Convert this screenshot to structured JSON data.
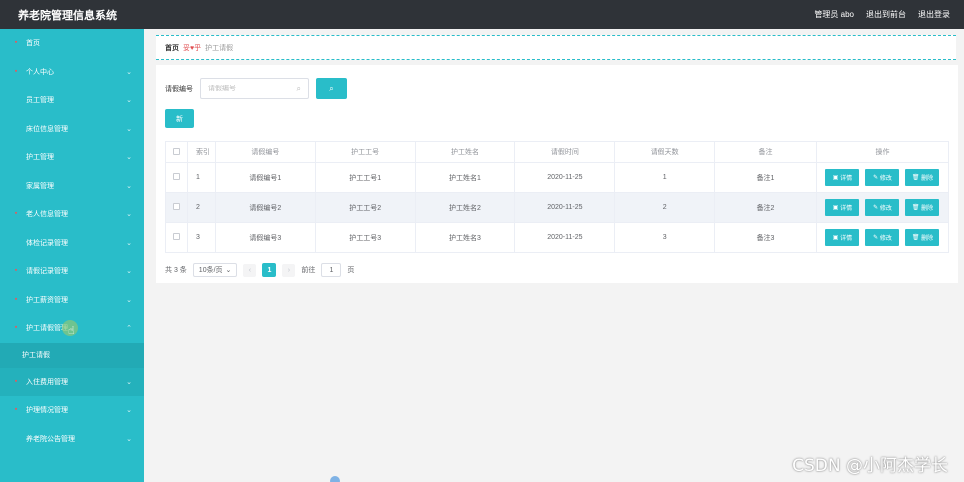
{
  "app": {
    "title": "养老院管理信息系统"
  },
  "topbar": {
    "user": "管理员 abo",
    "back": "退出到前台",
    "logout": "退出登录"
  },
  "sidebar": {
    "items": [
      {
        "label": "首页",
        "chevron": false
      },
      {
        "label": "个人中心",
        "chevron": true
      },
      {
        "label": "员工管理",
        "chevron": true
      },
      {
        "label": "床位信息管理",
        "chevron": true
      },
      {
        "label": "护工管理",
        "chevron": true
      },
      {
        "label": "家属管理",
        "chevron": true
      },
      {
        "label": "老人信息管理",
        "chevron": true
      },
      {
        "label": "体检记录管理",
        "chevron": true
      },
      {
        "label": "请假记录管理",
        "chevron": true
      },
      {
        "label": "护工薪资管理",
        "chevron": true
      },
      {
        "label": "护工请假管理",
        "chevron": true,
        "expanded": true
      }
    ],
    "sub_item": "护工请假",
    "items_after": [
      {
        "label": "入住费用管理",
        "chevron": true
      },
      {
        "label": "护理情况管理",
        "chevron": true
      },
      {
        "label": "养老院公告管理",
        "chevron": true
      }
    ]
  },
  "breadcrumb": {
    "home": "首页",
    "sep": "妥♥乎",
    "current": "护工请假"
  },
  "search": {
    "label": "请假编号",
    "placeholder": "请假编号",
    "button_icon": "search-icon"
  },
  "add_button": {
    "label": "新"
  },
  "table": {
    "headers": [
      "",
      "索引",
      "请假编号",
      "护工工号",
      "护工姓名",
      "请假时间",
      "请假天数",
      "备注",
      "操作"
    ],
    "rows": [
      {
        "index": "1",
        "code": "请假编号1",
        "worker_no": "护工工号1",
        "worker_name": "护工姓名1",
        "date": "2020-11-25",
        "days": "1",
        "remark": "备注1"
      },
      {
        "index": "2",
        "code": "请假编号2",
        "worker_no": "护工工号2",
        "worker_name": "护工姓名2",
        "date": "2020-11-25",
        "days": "2",
        "remark": "备注2"
      },
      {
        "index": "3",
        "code": "请假编号3",
        "worker_no": "护工工号3",
        "worker_name": "护工姓名3",
        "date": "2020-11-25",
        "days": "3",
        "remark": "备注3"
      }
    ],
    "ops": {
      "detail": "详情",
      "edit": "修改",
      "delete": "删除"
    }
  },
  "pager": {
    "total": "共 3 条",
    "size": "10条/页",
    "page": "1",
    "goto": "前往",
    "goto_value": "1",
    "page_unit": "页"
  },
  "watermark": "CSDN @小阿杰学长",
  "colors": {
    "accent": "#29bdc9",
    "topbar": "#2f3338",
    "icon_red": "#e8575b"
  }
}
